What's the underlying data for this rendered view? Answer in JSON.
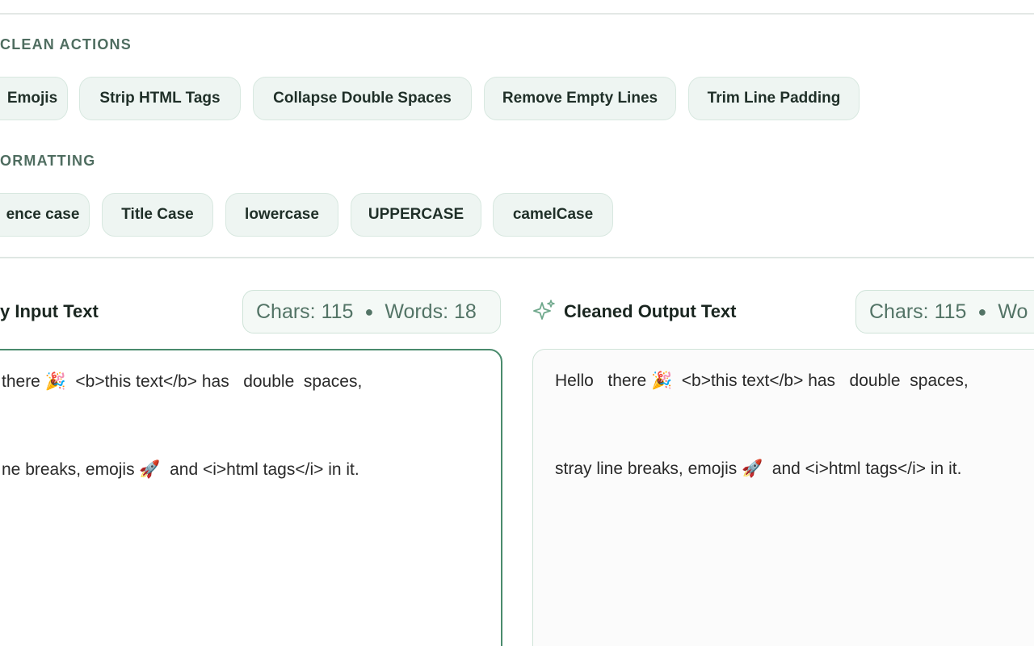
{
  "clean_actions": {
    "title": "CLEAN ACTIONS",
    "buttons": [
      "Emojis",
      "Strip HTML Tags",
      "Collapse Double Spaces",
      "Remove Empty Lines",
      "Trim Line Padding"
    ]
  },
  "formatting": {
    "title": "ORMATTING",
    "buttons": [
      "ence case",
      "Title Case",
      "lowercase",
      "UPPERCASE",
      "camelCase"
    ]
  },
  "input_panel": {
    "title": "y Input Text",
    "stats": {
      "chars": "Chars: 115",
      "words": "Words: 18"
    },
    "lines": [
      {
        "before": "there",
        "emoji": "🎉",
        "after": "  <b>this text</b> has   double  spaces,"
      },
      {
        "before": "ne breaks, emojis",
        "emoji": "🚀",
        "after": "  and <i>html tags</i> in it."
      }
    ]
  },
  "output_panel": {
    "title": "Cleaned Output Text",
    "stats": {
      "chars": "Chars: 115",
      "words": "Wo"
    },
    "lines": [
      {
        "before": "Hello   there",
        "emoji": "🎉",
        "after": "  <b>this text</b> has   double  spaces,"
      },
      {
        "before": "stray line breaks, emojis",
        "emoji": "🚀",
        "after": "  and <i>html tags</i> in it."
      }
    ]
  },
  "icons": {
    "sparkle": "sparkle-icon"
  },
  "colors": {
    "accent": "#4a8b6d",
    "chip_bg": "#eef5f2",
    "section_title": "#4f6d60"
  }
}
